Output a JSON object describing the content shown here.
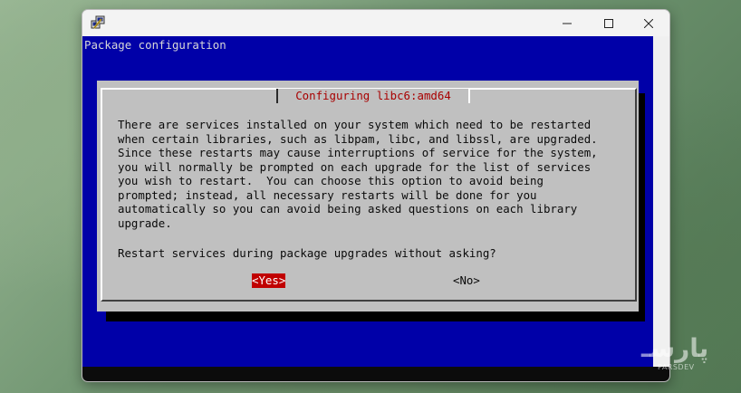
{
  "window": {
    "icon": "putty-icon",
    "minimize_label": "minimize",
    "maximize_label": "maximize",
    "close_label": "close"
  },
  "terminal": {
    "header": "Package configuration",
    "colors": {
      "background": "#0000a8",
      "dialog": "#c0c0c0",
      "title": "#a80000",
      "selected_button": "#c00000"
    }
  },
  "dialog": {
    "title": "Configuring libc6:amd64",
    "message": "There are services installed on your system which need to be restarted\nwhen certain libraries, such as libpam, libc, and libssl, are upgraded.\nSince these restarts may cause interruptions of service for the system,\nyou will normally be prompted on each upgrade for the list of services\nyou wish to restart.  You can choose this option to avoid being\nprompted; instead, all necessary restarts will be done for you\nautomatically so you can avoid being asked questions on each library\nupgrade.",
    "question": "Restart services during package upgrades without asking?",
    "yes_label": "<Yes>",
    "no_label": "<No>",
    "selected": "yes"
  },
  "watermark": {
    "logo": "پارسـ",
    "text": "PARSDEV"
  }
}
